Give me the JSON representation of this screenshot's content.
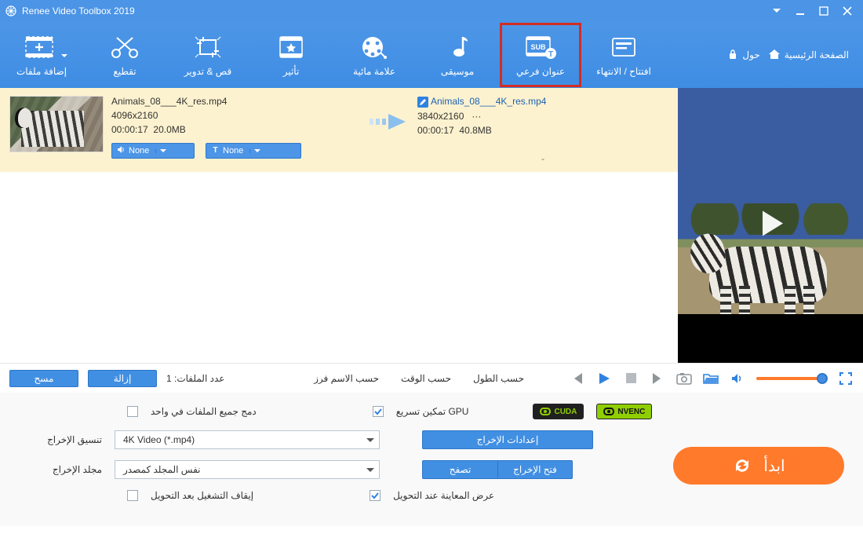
{
  "titlebar": {
    "title": "Renee Video Toolbox 2019"
  },
  "ribbon": {
    "tools": [
      {
        "label": "إضافة ملفات"
      },
      {
        "label": "تقطيع"
      },
      {
        "label": "قص & تدوير"
      },
      {
        "label": "تأثير"
      },
      {
        "label": "علامة مائية"
      },
      {
        "label": "موسيقى"
      },
      {
        "label": "عنوان فرعي"
      },
      {
        "label": "افتتاح / الانتهاء"
      }
    ],
    "links": {
      "about": "حول",
      "home": "الصفحة الرئيسية"
    }
  },
  "file": {
    "src": {
      "name": "Animals_08___4K_res.mp4",
      "res": "4096x2160",
      "dur": "00:00:17",
      "size": "20.0MB"
    },
    "dst": {
      "name": "Animals_08___4K_res.mp4",
      "res": "3840x2160",
      "more": "···",
      "dur": "00:00:17",
      "size": "40.8MB"
    },
    "audio_combo": "None",
    "sub_combo": "None"
  },
  "midbar": {
    "clear": "مسح",
    "remove": "إزالة",
    "count_label": "عدد الملفات: 1",
    "sort_name": "حسب الاسم فرز",
    "sort_time": "حسب الوقت",
    "sort_length": "حسب الطول"
  },
  "bottom": {
    "merge_label": "دمج جميع الملفات في واحد",
    "gpu_label": "تمكين تسريع GPU",
    "cuda": "CUDA",
    "nvenc": "NVENC",
    "out_format_label": "تنسيق الإخراج",
    "out_format_value": "4K Video (*.mp4)",
    "out_settings": "إعدادات الإخراج",
    "out_folder_label": "مجلد الإخراج",
    "out_folder_value": "نفس المجلد كمصدر",
    "open_output": "فتح الإخراج",
    "browse": "تصفح",
    "stop_after": "إيقاف التشغيل بعد التحويل",
    "preview_after": "عرض المعاينة عند التحويل",
    "start": "ابدأ"
  }
}
